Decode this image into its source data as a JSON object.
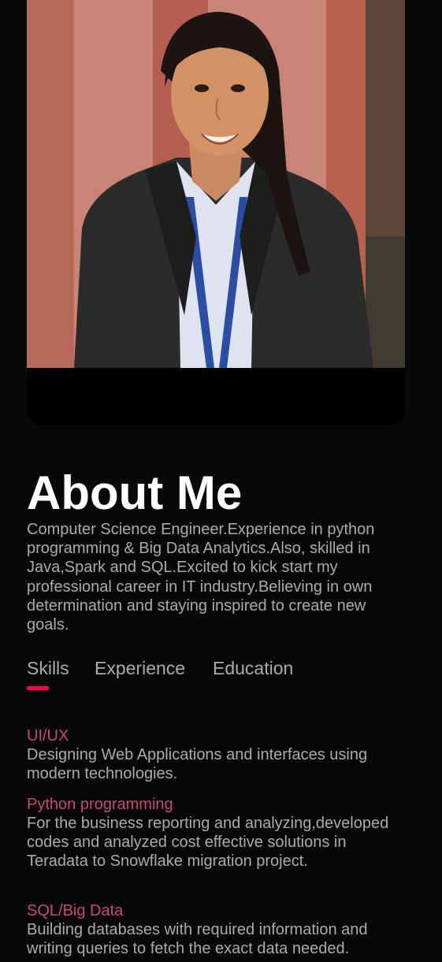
{
  "profile": {
    "photo_alt": "Profile photo"
  },
  "about": {
    "title": "About Me",
    "bio": "Computer Science Engineer.Experience in python programming & Big Data Analytics.Also, skilled in Java,Spark and SQL.Excited to kick start my professional career in IT industry.Believing in own determination and staying inspired to create new goals."
  },
  "tabs": [
    {
      "label": "Skills",
      "active": true
    },
    {
      "label": "Experience",
      "active": false
    },
    {
      "label": "Education",
      "active": false
    }
  ],
  "skills": [
    {
      "title": "UI/UX",
      "description": "Designing Web Applications and interfaces using modern technologies."
    },
    {
      "title": "Python programming",
      "description": "For the business reporting and analyzing,developed codes and analyzed cost effective solutions in Teradata to Snowflake migration project."
    },
    {
      "title": "SQL/Big Data",
      "description": "Building databases with required information and writing queries to fetch the exact data needed."
    }
  ],
  "colors": {
    "accent": "#ff004f",
    "skill_title": "#c94b6d",
    "background": "#080808",
    "text": "#ababab"
  }
}
